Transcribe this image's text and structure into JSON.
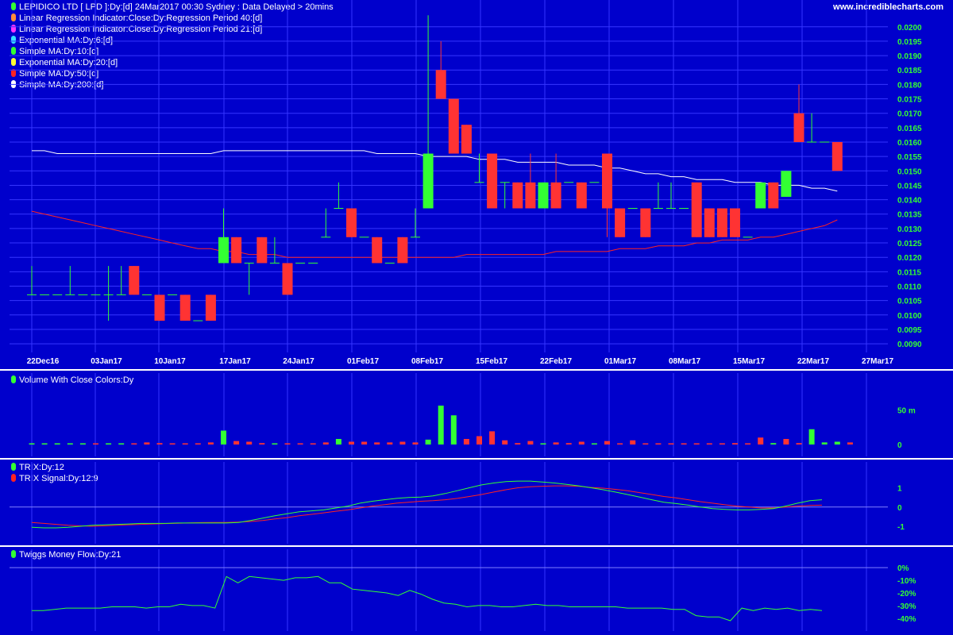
{
  "header": {
    "title": "LEPIDICO LTD [ LPD ]:Dy:[d]  24Mar2017 00:30 Sydney : Data Delayed > 20mins",
    "site": "www.incrediblecharts.com"
  },
  "colors": {
    "background": "#0000cc",
    "grid": "#3535ff",
    "up_candle": "#33ff33",
    "down_candle": "#ff3333",
    "sma200": "#ffffff",
    "sma50": "#ff2222",
    "axis_text": "#ffffff",
    "value_text": "#33ff33",
    "trix": "#33ff33",
    "trix_signal": "#ff2222",
    "money_flow": "#33ff33"
  },
  "legend": [
    {
      "label": "Linear Regression Indicator:Close:Dy:Regression Period 40:[d]",
      "color": "#ff8c3c"
    },
    {
      "label": "Linear Regression Indicator:Close:Dy:Regression Period 21:[d]",
      "color": "#ff33ff"
    },
    {
      "label": "Exponential MA:Dy:6:[d]",
      "color": "#33e0ff"
    },
    {
      "label": "Simple MA:Dy:10:[d]",
      "color": "#33ff33"
    },
    {
      "label": "Exponential MA:Dy:20:[d]",
      "color": "#ffff33"
    },
    {
      "label": "Simple MA:Dy:50:[d]",
      "color": "#ff2222"
    },
    {
      "label": "Simple MA:Dy:200:[d]",
      "color": "#ffffff"
    }
  ],
  "panels": {
    "volume_title": "Volume With Close Colors:Dy",
    "trix_title": "TRIX:Dy:12",
    "trix_signal_title": "TRIX Signal:Dy:12:9",
    "mf_title": "Twiggs Money Flow:Dy:21"
  },
  "chart_data": [
    {
      "type": "candlestick",
      "title": "LEPIDICO LTD [ LPD ]:Dy:[d]",
      "x_tick_labels": [
        "22Dec16",
        "03Jan17",
        "10Jan17",
        "17Jan17",
        "24Jan17",
        "01Feb17",
        "08Feb17",
        "15Feb17",
        "22Feb17",
        "01Mar17",
        "08Mar17",
        "15Mar17",
        "22Mar17",
        "27Mar17"
      ],
      "y_tick_labels": [
        "0.0200",
        "0.0195",
        "0.0190",
        "0.0185",
        "0.0180",
        "0.0175",
        "0.0170",
        "0.0165",
        "0.0160",
        "0.0155",
        "0.0150",
        "0.0145",
        "0.0140",
        "0.0135",
        "0.0130",
        "0.0125",
        "0.0120",
        "0.0115",
        "0.0110",
        "0.0105",
        "0.0100",
        "0.0095",
        "0.0090"
      ],
      "ylim": [
        0.0087,
        0.0206
      ],
      "candles": [
        {
          "o": 0.0107,
          "h": 0.0117,
          "l": 0.0107,
          "c": 0.0107
        },
        {
          "o": 0.0107,
          "h": 0.0107,
          "l": 0.0107,
          "c": 0.0107
        },
        {
          "o": 0.0107,
          "h": 0.0107,
          "l": 0.0107,
          "c": 0.0107
        },
        {
          "o": 0.0107,
          "h": 0.0117,
          "l": 0.0107,
          "c": 0.0107
        },
        {
          "o": 0.0107,
          "h": 0.0107,
          "l": 0.0107,
          "c": 0.0107
        },
        {
          "o": 0.0107,
          "h": 0.0107,
          "l": 0.0107,
          "c": 0.0107
        },
        {
          "o": 0.0107,
          "h": 0.0117,
          "l": 0.0098,
          "c": 0.0107
        },
        {
          "o": 0.0107,
          "h": 0.0117,
          "l": 0.0107,
          "c": 0.0107
        },
        {
          "o": 0.0117,
          "h": 0.0117,
          "l": 0.0107,
          "c": 0.0107
        },
        {
          "o": 0.0107,
          "h": 0.0107,
          "l": 0.0107,
          "c": 0.0107
        },
        {
          "o": 0.0107,
          "h": 0.0107,
          "l": 0.0098,
          "c": 0.0098
        },
        {
          "o": 0.0107,
          "h": 0.0107,
          "l": 0.0107,
          "c": 0.0107
        },
        {
          "o": 0.0107,
          "h": 0.0107,
          "l": 0.0098,
          "c": 0.0098
        },
        {
          "o": 0.0098,
          "h": 0.0098,
          "l": 0.0098,
          "c": 0.0098
        },
        {
          "o": 0.0107,
          "h": 0.0107,
          "l": 0.0098,
          "c": 0.0098
        },
        {
          "o": 0.0118,
          "h": 0.0137,
          "l": 0.0118,
          "c": 0.0127
        },
        {
          "o": 0.0127,
          "h": 0.0127,
          "l": 0.0118,
          "c": 0.0118
        },
        {
          "o": 0.0118,
          "h": 0.0118,
          "l": 0.0107,
          "c": 0.0118
        },
        {
          "o": 0.0127,
          "h": 0.0127,
          "l": 0.0118,
          "c": 0.0118
        },
        {
          "o": 0.0118,
          "h": 0.0127,
          "l": 0.0118,
          "c": 0.0118
        },
        {
          "o": 0.0118,
          "h": 0.0118,
          "l": 0.0107,
          "c": 0.0107
        },
        {
          "o": 0.0118,
          "h": 0.0118,
          "l": 0.0118,
          "c": 0.0118
        },
        {
          "o": 0.0118,
          "h": 0.0118,
          "l": 0.0118,
          "c": 0.0118
        },
        {
          "o": 0.0127,
          "h": 0.0137,
          "l": 0.0127,
          "c": 0.0127
        },
        {
          "o": 0.0137,
          "h": 0.0146,
          "l": 0.0137,
          "c": 0.0137
        },
        {
          "o": 0.0137,
          "h": 0.0137,
          "l": 0.0127,
          "c": 0.0127
        },
        {
          "o": 0.0127,
          "h": 0.0127,
          "l": 0.0127,
          "c": 0.0127
        },
        {
          "o": 0.0127,
          "h": 0.0127,
          "l": 0.0118,
          "c": 0.0118
        },
        {
          "o": 0.0118,
          "h": 0.0118,
          "l": 0.0118,
          "c": 0.0118
        },
        {
          "o": 0.0127,
          "h": 0.0127,
          "l": 0.0118,
          "c": 0.0118
        },
        {
          "o": 0.0127,
          "h": 0.0137,
          "l": 0.0127,
          "c": 0.0127
        },
        {
          "o": 0.0137,
          "h": 0.0204,
          "l": 0.0137,
          "c": 0.0156
        },
        {
          "o": 0.0185,
          "h": 0.0195,
          "l": 0.0175,
          "c": 0.0175
        },
        {
          "o": 0.0175,
          "h": 0.0175,
          "l": 0.0156,
          "c": 0.0156
        },
        {
          "o": 0.0166,
          "h": 0.0166,
          "l": 0.0156,
          "c": 0.0156
        },
        {
          "o": 0.0146,
          "h": 0.0156,
          "l": 0.0146,
          "c": 0.0146
        },
        {
          "o": 0.0156,
          "h": 0.0156,
          "l": 0.0137,
          "c": 0.0137
        },
        {
          "o": 0.0146,
          "h": 0.0146,
          "l": 0.0137,
          "c": 0.0146
        },
        {
          "o": 0.0146,
          "h": 0.0146,
          "l": 0.0137,
          "c": 0.0137
        },
        {
          "o": 0.0146,
          "h": 0.0156,
          "l": 0.0137,
          "c": 0.0137
        },
        {
          "o": 0.0137,
          "h": 0.0146,
          "l": 0.0137,
          "c": 0.0146
        },
        {
          "o": 0.0146,
          "h": 0.0156,
          "l": 0.0137,
          "c": 0.0137
        },
        {
          "o": 0.0146,
          "h": 0.0146,
          "l": 0.0146,
          "c": 0.0146
        },
        {
          "o": 0.0146,
          "h": 0.0146,
          "l": 0.0137,
          "c": 0.0137
        },
        {
          "o": 0.0146,
          "h": 0.0146,
          "l": 0.0146,
          "c": 0.0146
        },
        {
          "o": 0.0156,
          "h": 0.0156,
          "l": 0.0127,
          "c": 0.0137
        },
        {
          "o": 0.0137,
          "h": 0.0137,
          "l": 0.0127,
          "c": 0.0127
        },
        {
          "o": 0.0137,
          "h": 0.0137,
          "l": 0.0137,
          "c": 0.0137
        },
        {
          "o": 0.0137,
          "h": 0.0137,
          "l": 0.0127,
          "c": 0.0127
        },
        {
          "o": 0.0137,
          "h": 0.0146,
          "l": 0.0137,
          "c": 0.0137
        },
        {
          "o": 0.0137,
          "h": 0.0146,
          "l": 0.0137,
          "c": 0.0137
        },
        {
          "o": 0.0137,
          "h": 0.0137,
          "l": 0.0137,
          "c": 0.0137
        },
        {
          "o": 0.0146,
          "h": 0.0146,
          "l": 0.0127,
          "c": 0.0127
        },
        {
          "o": 0.0137,
          "h": 0.0137,
          "l": 0.0127,
          "c": 0.0127
        },
        {
          "o": 0.0137,
          "h": 0.0137,
          "l": 0.0127,
          "c": 0.0127
        },
        {
          "o": 0.0137,
          "h": 0.0137,
          "l": 0.0127,
          "c": 0.0127
        },
        {
          "o": 0.0127,
          "h": 0.0127,
          "l": 0.0127,
          "c": 0.0127
        },
        {
          "o": 0.0137,
          "h": 0.0146,
          "l": 0.0137,
          "c": 0.0146
        },
        {
          "o": 0.0146,
          "h": 0.0146,
          "l": 0.0137,
          "c": 0.0137
        },
        {
          "o": 0.0141,
          "h": 0.015,
          "l": 0.0141,
          "c": 0.015
        },
        {
          "o": 0.017,
          "h": 0.018,
          "l": 0.016,
          "c": 0.016
        },
        {
          "o": 0.016,
          "h": 0.017,
          "l": 0.016,
          "c": 0.016
        },
        {
          "o": 0.016,
          "h": 0.016,
          "l": 0.016,
          "c": 0.016
        },
        {
          "o": 0.016,
          "h": 0.016,
          "l": 0.015,
          "c": 0.015
        }
      ],
      "overlays": [
        {
          "name": "Simple MA:Dy:200:[d]",
          "color": "#ffffff",
          "values": [
            0.0157,
            0.0157,
            0.0156,
            0.0156,
            0.0156,
            0.0156,
            0.0156,
            0.0156,
            0.0156,
            0.0156,
            0.0156,
            0.0156,
            0.0156,
            0.0156,
            0.0156,
            0.0157,
            0.0157,
            0.0157,
            0.0157,
            0.0157,
            0.0157,
            0.0157,
            0.0157,
            0.0157,
            0.0157,
            0.0157,
            0.0157,
            0.0156,
            0.0156,
            0.0156,
            0.0156,
            0.0155,
            0.0155,
            0.0155,
            0.0155,
            0.0154,
            0.0154,
            0.0154,
            0.0153,
            0.0153,
            0.0153,
            0.0153,
            0.0152,
            0.0152,
            0.0152,
            0.0151,
            0.0151,
            0.015,
            0.0149,
            0.0149,
            0.0148,
            0.0148,
            0.0147,
            0.0147,
            0.0147,
            0.0146,
            0.0146,
            0.0146,
            0.0145,
            0.0145,
            0.0145,
            0.0144,
            0.0144,
            0.0143
          ]
        },
        {
          "name": "Simple MA:Dy:50:[d]",
          "color": "#ff2222",
          "values": [
            0.0136,
            0.0135,
            0.0134,
            0.0133,
            0.0132,
            0.0131,
            0.013,
            0.0129,
            0.0128,
            0.0127,
            0.0126,
            0.0125,
            0.0124,
            0.0123,
            0.0123,
            0.0122,
            0.0122,
            0.0121,
            0.0121,
            0.0121,
            0.012,
            0.012,
            0.012,
            0.012,
            0.012,
            0.012,
            0.012,
            0.012,
            0.012,
            0.012,
            0.012,
            0.012,
            0.012,
            0.012,
            0.0121,
            0.0121,
            0.0121,
            0.0121,
            0.0121,
            0.0121,
            0.0121,
            0.0122,
            0.0122,
            0.0122,
            0.0122,
            0.0122,
            0.0123,
            0.0123,
            0.0123,
            0.0124,
            0.0124,
            0.0124,
            0.0125,
            0.0125,
            0.0126,
            0.0126,
            0.0126,
            0.0127,
            0.0127,
            0.0128,
            0.0129,
            0.013,
            0.0131,
            0.0133
          ]
        }
      ]
    },
    {
      "type": "bar",
      "title": "Volume With Close Colors:Dy",
      "y_tick_labels": [
        "50 m",
        "0"
      ],
      "ylim": [
        0,
        80
      ],
      "values": [
        1.5,
        0.8,
        1,
        1.2,
        1,
        0.8,
        1,
        0.8,
        1.5,
        3,
        2,
        1.5,
        1.5,
        1.2,
        3,
        20,
        5,
        4,
        2,
        1.5,
        1,
        1,
        1,
        3,
        8,
        4,
        4,
        3,
        3,
        4,
        3,
        7,
        56,
        42,
        8,
        12,
        19,
        6,
        2,
        5,
        1,
        3,
        2,
        4,
        1,
        5,
        1,
        6,
        1,
        1,
        1,
        1,
        1,
        1,
        1,
        2,
        1,
        10,
        2,
        8,
        2,
        22,
        3,
        4,
        3
      ],
      "colors": [
        "up",
        "up",
        "up",
        "up",
        "up",
        "down",
        "up",
        "up",
        "down",
        "down",
        "down",
        "down",
        "down",
        "down",
        "down",
        "up",
        "down",
        "down",
        "down",
        "up",
        "down",
        "down",
        "down",
        "down",
        "up",
        "down",
        "down",
        "down",
        "down",
        "down",
        "down",
        "up",
        "up",
        "up",
        "down",
        "down",
        "down",
        "down",
        "down",
        "down",
        "up",
        "down",
        "down",
        "down",
        "up",
        "down",
        "down",
        "down",
        "down",
        "down",
        "down",
        "down",
        "down",
        "down",
        "down",
        "down",
        "down",
        "down",
        "up",
        "down",
        "down",
        "up",
        "up",
        "up",
        "down"
      ]
    },
    {
      "type": "line",
      "title": "TRIX:Dy:12",
      "y_tick_labels": [
        "1",
        "0",
        "-1"
      ],
      "ylim": [
        -1.7,
        1.6
      ],
      "series": [
        {
          "name": "TRIX:Dy:12",
          "color": "#33ff33",
          "values": [
            -1.05,
            -1.08,
            -1.08,
            -1.05,
            -1.0,
            -0.95,
            -0.92,
            -0.9,
            -0.88,
            -0.85,
            -0.85,
            -0.85,
            -0.83,
            -0.83,
            -0.83,
            -0.83,
            -0.83,
            -0.8,
            -0.7,
            -0.58,
            -0.45,
            -0.35,
            -0.25,
            -0.2,
            -0.15,
            -0.05,
            0.05,
            0.2,
            0.3,
            0.38,
            0.45,
            0.5,
            0.52,
            0.58,
            0.7,
            0.85,
            1.0,
            1.15,
            1.25,
            1.32,
            1.35,
            1.35,
            1.3,
            1.25,
            1.18,
            1.1,
            1.0,
            0.9,
            0.78,
            0.65,
            0.52,
            0.38,
            0.25,
            0.18,
            0.1,
            0.0,
            -0.08,
            -0.12,
            -0.15,
            -0.15,
            -0.12,
            -0.08,
            0.05,
            0.2,
            0.33,
            0.38
          ]
        },
        {
          "name": "TRIX Signal:Dy:12:9",
          "color": "#ff2222",
          "values": [
            -0.8,
            -0.85,
            -0.9,
            -0.95,
            -0.98,
            -1.0,
            -0.98,
            -0.95,
            -0.92,
            -0.9,
            -0.88,
            -0.86,
            -0.84,
            -0.82,
            -0.81,
            -0.8,
            -0.8,
            -0.78,
            -0.75,
            -0.7,
            -0.62,
            -0.55,
            -0.45,
            -0.38,
            -0.3,
            -0.22,
            -0.15,
            -0.05,
            0.05,
            0.12,
            0.2,
            0.25,
            0.3,
            0.33,
            0.38,
            0.45,
            0.55,
            0.65,
            0.78,
            0.9,
            1.0,
            1.05,
            1.08,
            1.1,
            1.1,
            1.08,
            1.02,
            0.98,
            0.92,
            0.85,
            0.75,
            0.65,
            0.55,
            0.48,
            0.38,
            0.28,
            0.2,
            0.12,
            0.05,
            0.0,
            -0.05,
            -0.05,
            0.0,
            0.05,
            0.08,
            0.1
          ]
        }
      ]
    },
    {
      "type": "line",
      "title": "Twiggs Money Flow:Dy:21",
      "y_tick_labels": [
        "0%",
        "-10%",
        "-20%",
        "-30%",
        "-40%"
      ],
      "ylim": [
        -42,
        2
      ],
      "series": [
        {
          "name": "Twiggs Money Flow:Dy:21",
          "color": "#33ff33",
          "values": [
            -34,
            -34,
            -33,
            -32,
            -32,
            -32,
            -32,
            -31,
            -31,
            -31,
            -32,
            -31,
            -31,
            -29,
            -30,
            -30,
            -32,
            -7,
            -12,
            -7,
            -8,
            -9,
            -10,
            -8,
            -8,
            -7,
            -12,
            -12,
            -17,
            -18,
            -19,
            -20,
            -22,
            -18,
            -21,
            -25,
            -28,
            -29,
            -31,
            -30,
            -30,
            -31,
            -31,
            -30,
            -29,
            -30,
            -30,
            -31,
            -31,
            -31,
            -31,
            -31,
            -32,
            -32,
            -32,
            -32,
            -33,
            -33,
            -38,
            -39,
            -39,
            -42,
            -32,
            -34,
            -32,
            -33,
            -32,
            -34,
            -33,
            -34
          ]
        }
      ]
    }
  ]
}
